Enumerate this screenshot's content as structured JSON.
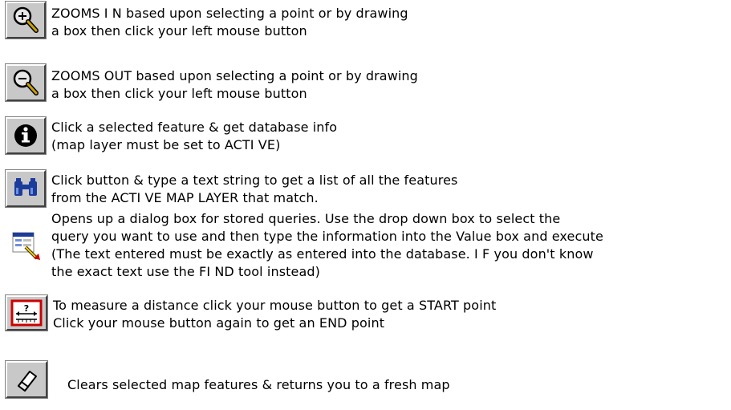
{
  "tools": [
    {
      "icon": "zoom-in-icon",
      "lines": [
        "ZOOMS I N based upon selecting a point or by drawing",
        "a box then click your left mouse button"
      ]
    },
    {
      "icon": "zoom-out-icon",
      "lines": [
        "ZOOMS OUT based upon selecting a point or by drawing",
        "a box then click your left mouse button"
      ]
    },
    {
      "icon": "info-icon",
      "lines": [
        "Click a selected feature & get database info",
        "(map layer must be set to ACTI VE)"
      ]
    },
    {
      "icon": "binoculars-icon",
      "lines": [
        "Click button & type a text string to get a list of all the features",
        "from the ACTI VE MAP LAYER that match."
      ]
    },
    {
      "icon": "query-icon",
      "lines": [
        "Opens up a dialog box for stored queries. Use the drop down box to select the",
        "query you want to use and then type the information into the Value box and execute",
        "(The text entered must be exactly as entered into the database. I F you don't  know",
        "the exact text use the FI ND tool instead)"
      ]
    },
    {
      "icon": "measure-icon",
      "lines": [
        "To measure a distance click your mouse button to get a START point",
        "Click your mouse button again to get an END point"
      ]
    },
    {
      "icon": "eraser-icon",
      "lines": [
        "Clears selected map features & returns you to a fresh map"
      ]
    }
  ],
  "colors": {
    "button_face": "#c8c8c8",
    "magnifier_handle": "#c8a000",
    "binoculars": "#1c3c9c",
    "measure_red": "#cc0000"
  }
}
